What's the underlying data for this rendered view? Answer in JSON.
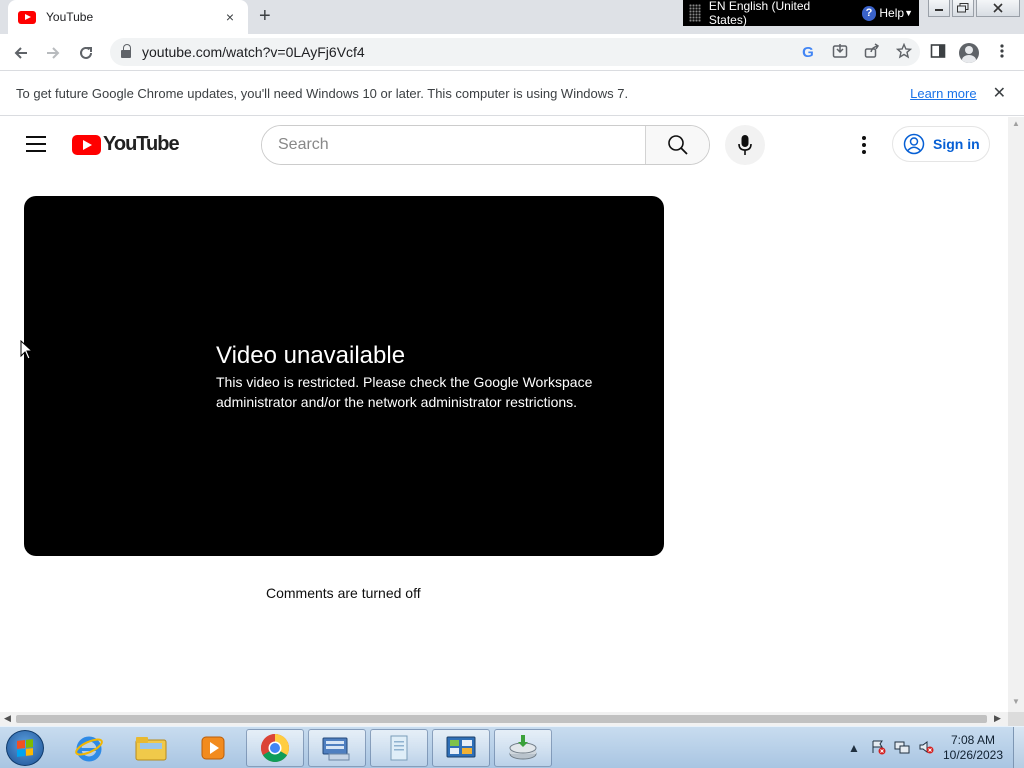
{
  "browser": {
    "tab": {
      "title": "YouTube",
      "favicon": "youtube-favicon",
      "close_icon": "×"
    },
    "new_tab_icon": "+",
    "url": "youtube.com/watch?v=0LAyFj6Vcf4",
    "language_bar": {
      "text": "EN English (United States)",
      "help": "Help"
    }
  },
  "infobar": {
    "message": "To get future Google Chrome updates, you'll need Windows 10 or later. This computer is using Windows 7.",
    "link": "Learn more",
    "close_icon": "✕"
  },
  "youtube": {
    "logo_text": "YouTube",
    "search": {
      "placeholder": "Search"
    },
    "sign_in": "Sign in",
    "player": {
      "error_title": "Video unavailable",
      "error_message": "This video is restricted. Please check the Google Workspace administrator and/or the network administrator restrictions."
    },
    "comments_status": "Comments are turned off"
  },
  "taskbar": {
    "time": "7:08 AM",
    "date": "10/26/2023"
  },
  "colors": {
    "youtube_red": "#ff0000",
    "link_blue": "#1a73e8",
    "signin_blue": "#065fd4",
    "player_bg": "#000000"
  }
}
